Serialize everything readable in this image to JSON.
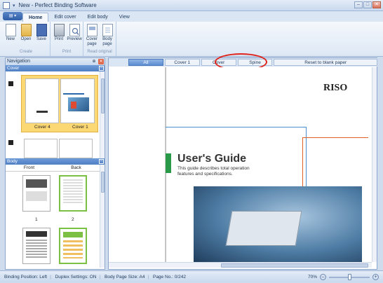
{
  "window": {
    "title": "New - Perfect Binding Software",
    "qa_label": "▾"
  },
  "tabs": [
    {
      "label": "Home"
    },
    {
      "label": "Edit cover"
    },
    {
      "label": "Edit body"
    },
    {
      "label": "View"
    }
  ],
  "ribbon": {
    "groups": [
      {
        "label": "Create",
        "buttons": [
          {
            "label": "New",
            "icon": "new-document-icon"
          },
          {
            "label": "Open",
            "icon": "open-folder-icon"
          },
          {
            "label": "Save",
            "icon": "save-disk-icon"
          }
        ]
      },
      {
        "label": "Print",
        "buttons": [
          {
            "label": "Print",
            "icon": "printer-icon"
          },
          {
            "label": "Preview",
            "icon": "print-preview-icon"
          }
        ]
      },
      {
        "label": "Read original",
        "buttons": [
          {
            "label": "Cover page",
            "icon": "cover-page-icon"
          },
          {
            "label": "Body page",
            "icon": "body-page-icon"
          }
        ]
      }
    ]
  },
  "navigation": {
    "title": "Navigation",
    "cover_section": "Cover",
    "cover_labels": [
      "Cover 4",
      "Cover 1"
    ],
    "body_section": "Body",
    "body_headers": [
      "Front",
      "Back"
    ],
    "page_numbers": [
      "1",
      "2"
    ]
  },
  "workspace": {
    "tabs": [
      {
        "label": "All",
        "active": true
      },
      {
        "label": "Cover 1"
      },
      {
        "label": "Cover"
      },
      {
        "label": "Spine"
      },
      {
        "label": "Reset to blank paper"
      }
    ],
    "document": {
      "brand": "RISO",
      "heading": "User's Guide",
      "subtitle": "This guide describes total operation features and specifications."
    }
  },
  "status": {
    "binding": "Binding Position: Left",
    "duplex": "Duplex Settings: ON",
    "page_size": "Body Page Size: A4",
    "page_no": "Page No.: 0/242",
    "zoom": "70%",
    "zoom_level": 0.5
  }
}
